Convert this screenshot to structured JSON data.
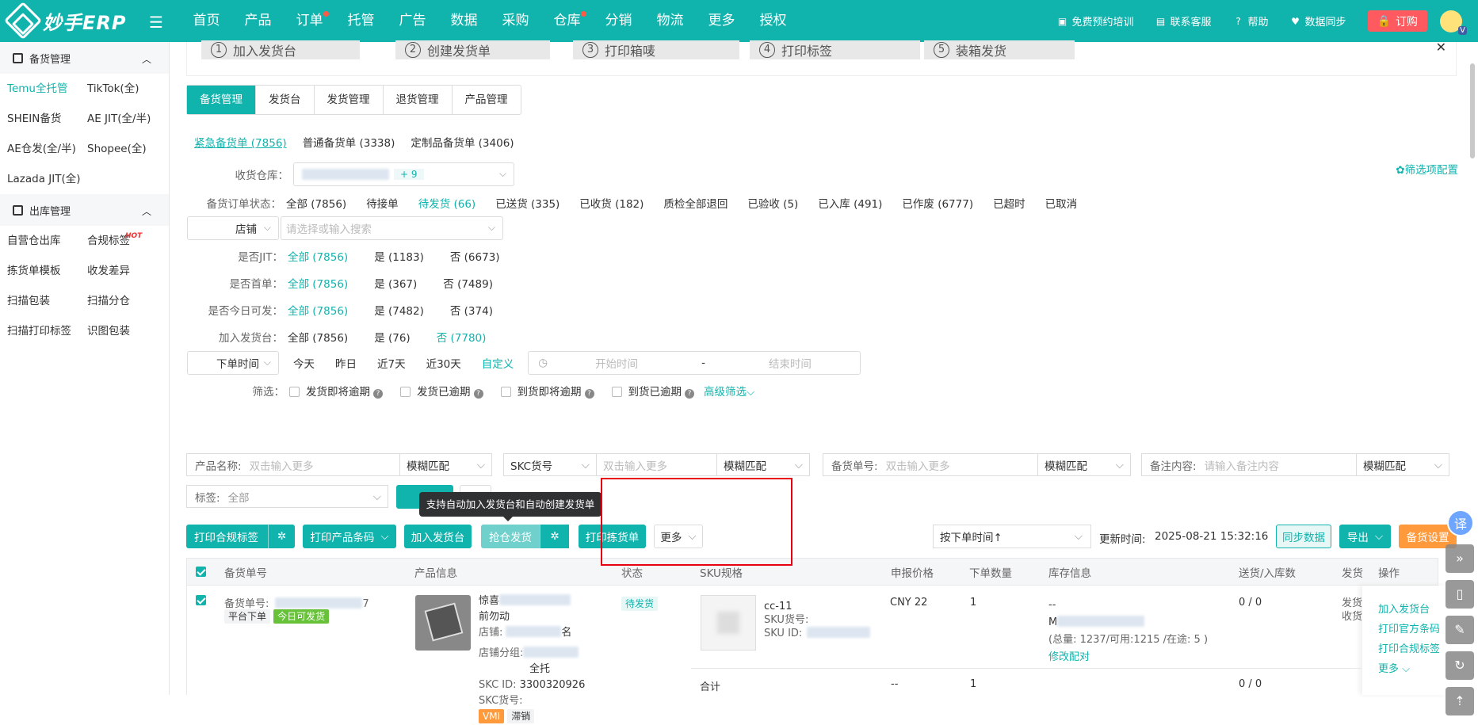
{
  "topbar": {
    "logo": "妙手ERP",
    "nav": [
      {
        "label": "首页",
        "dot": false
      },
      {
        "label": "产品",
        "dot": false
      },
      {
        "label": "订单",
        "dot": true
      },
      {
        "label": "托管",
        "dot": false
      },
      {
        "label": "广告",
        "dot": false
      },
      {
        "label": "数据",
        "dot": false
      },
      {
        "label": "采购",
        "dot": false
      },
      {
        "label": "仓库",
        "dot": true
      },
      {
        "label": "分销",
        "dot": false
      },
      {
        "label": "物流",
        "dot": false
      },
      {
        "label": "更多",
        "dot": false
      },
      {
        "label": "授权",
        "dot": false
      }
    ],
    "tools": [
      "免费预约培训",
      "联系客服",
      "帮助",
      "数据同步"
    ],
    "subscribe": "订购",
    "accent": "#11b3ad"
  },
  "sidebar": {
    "section1": "备货管理",
    "section1_items": [
      "Temu全托管",
      "TikTok(全)",
      "SHEIN备货",
      "AE JIT(全/半)",
      "AE仓发(全/半)",
      "Shopee(全)",
      "Lazada JIT(全)"
    ],
    "section2": "出库管理",
    "section2_items": [
      "自营仓出库",
      "合规标签",
      "拣货单模板",
      "收发差异",
      "扫描包装",
      "扫描分仓",
      "扫描打印标签",
      "识图包装"
    ],
    "hot_badge": "HOT"
  },
  "steps": [
    "加入发货台",
    "创建发货单",
    "打印箱唛",
    "打印标签",
    "装箱发货"
  ],
  "step_nums": [
    "1",
    "2",
    "3",
    "4",
    "5"
  ],
  "tabs": [
    "备货管理",
    "发货台",
    "发货管理",
    "退货管理",
    "产品管理"
  ],
  "subtabs": [
    "紧急备货单 (7856)",
    "普通备货单 (3338)",
    "定制品备货单 (3406)"
  ],
  "filters": {
    "warehouse_label": "收货仓库：",
    "warehouse_more": "+ 9",
    "filter_config": "筛选项配置",
    "status_label": "备货订单状态：",
    "status_opts": [
      "全部 (7856)",
      "待接单",
      "待发货 (66)",
      "已送货 (335)",
      "已收货 (182)",
      "质检全部退回",
      "已验收 (5)",
      "已入库 (491)",
      "已作废 (6777)",
      "已超时",
      "已取消"
    ],
    "shop_select": "店铺",
    "shop_placeholder": "请选择或输入搜索",
    "jit_label": "是否JIT：",
    "jit_opts": [
      "全部 (7856)",
      "是 (1183)",
      "否 (6673)"
    ],
    "first_label": "是否首单：",
    "first_opts": [
      "全部 (7856)",
      "是 (367)",
      "否 (7489)"
    ],
    "today_label": "是否今日可发：",
    "today_opts": [
      "全部 (7856)",
      "是 (7482)",
      "否 (374)"
    ],
    "desk_label": "加入发货台：",
    "desk_opts": [
      "全部 (7856)",
      "是 (76)",
      "否 (7780)"
    ],
    "time_select": "下单时间",
    "time_opts": [
      "今天",
      "昨日",
      "近7天",
      "近30天",
      "自定义"
    ],
    "start_ph": "开始时间",
    "end_ph": "结束时间",
    "dash": "-",
    "screen_label": "筛选：",
    "screen_opts": [
      "发货即将逾期",
      "发货已逾期",
      "到货即将逾期",
      "到货已逾期"
    ],
    "advanced": "高级筛选"
  },
  "search": {
    "product_label": "产品名称:",
    "product_ph": "双击输入更多",
    "fuzzy": "模糊匹配",
    "skc_select": "SKC货号",
    "skc_ph": "双击输入更多",
    "order_label": "备货单号:",
    "order_ph": "双击输入更多",
    "note_label": "备注内容:",
    "note_ph": "请输入备注内容",
    "tag_label": "标签:",
    "tag_value": "全部"
  },
  "tooltip": "支持自动加入发货台和自动创建发货单",
  "actions": {
    "print_compliance": "打印合规标签",
    "print_barcode": "打印产品条码",
    "add_desk": "加入发货台",
    "grab_ship": "抢仓发货",
    "print_pick": "打印拣货单",
    "more": "更多",
    "sort": "按下单时间↑",
    "updated_label": "更新时间:",
    "updated_time": "2025-08-21 15:32:16",
    "sync": "同步数据",
    "export": "导出",
    "settings": "备货设置"
  },
  "table": {
    "headers": [
      "备货单号",
      "产品信息",
      "状态",
      "SKU规格",
      "申报价格",
      "下单数量",
      "库存信息",
      "送货/入库数",
      "发货",
      "操作"
    ],
    "row": {
      "order_prefix": "备货单号:",
      "order_suffix": "7",
      "tag_platform": "平台下单",
      "tag_today": "今日可发货",
      "product_line1": "惊喜",
      "product_line2": "前勿动",
      "shop_label": "店铺:",
      "shop_suffix": "名",
      "shop_group": "店铺分组:",
      "shop_group_val": "全托",
      "skc_id_label": "SKC ID:",
      "skc_id": "3300320926",
      "skc_no_label": "SKC货号:",
      "tag_vmi": "VMI",
      "tag_slow": "滞销",
      "status": "待发货",
      "sku_spec": "cc-11",
      "sku_no_label": "SKU货号:",
      "sku_id_label": "SKU ID:",
      "price": "CNY 22",
      "qty": "1",
      "stock_dash": "--",
      "stock_m": "M",
      "stock_total": "(总量: 1237/可用:1215 /在途: 5 )",
      "stock_link": "修改配对",
      "delivered": "0 / 0",
      "ship_line1": "发货",
      "ship_line2": "收货",
      "ops": [
        "加入发货台",
        "打印官方条码",
        "打印合规标签",
        "更多"
      ],
      "sum_label": "合计",
      "sum_price": "--",
      "sum_qty": "1",
      "sum_delivered": "0 / 0"
    }
  },
  "side_tools": {
    "translate": "译"
  }
}
